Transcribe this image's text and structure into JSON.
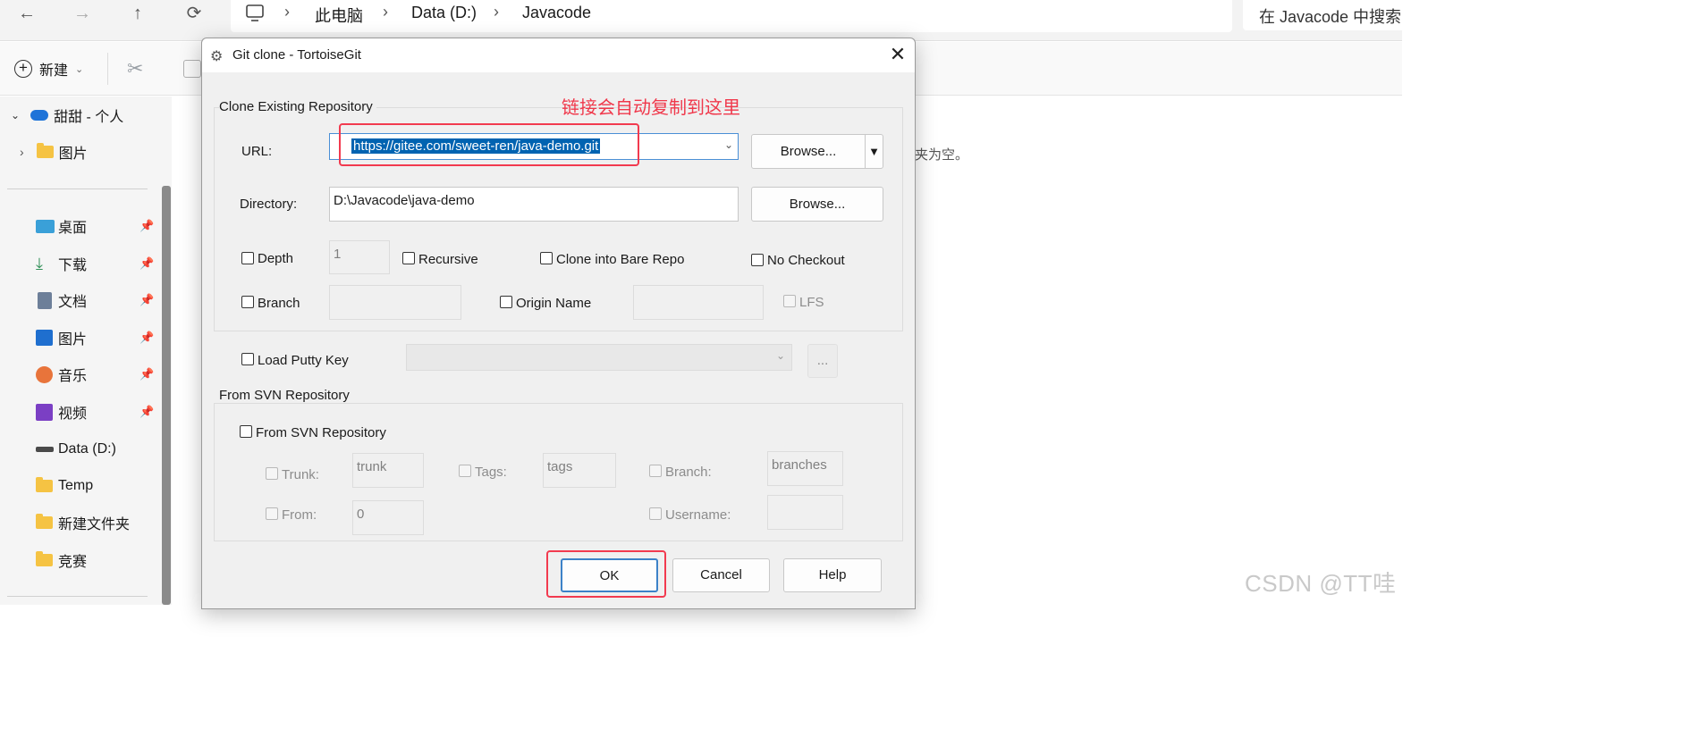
{
  "explorer": {
    "nav": {
      "back": "←",
      "forward": "→",
      "up": "↑",
      "refresh": "⟳"
    },
    "breadcrumb": [
      "此电脑",
      "Data (D:)",
      "Javacode"
    ],
    "search_placeholder": "在 Javacode 中搜索",
    "toolbar": {
      "new_label": "新建"
    },
    "sidebar": {
      "onedrive": "甜甜 - 个人",
      "onedrive_child": "图片",
      "quick": [
        {
          "label": "桌面",
          "icon": "desktop-icon"
        },
        {
          "label": "下载",
          "icon": "download-icon"
        },
        {
          "label": "文档",
          "icon": "document-icon"
        },
        {
          "label": "图片",
          "icon": "pictures-icon"
        },
        {
          "label": "音乐",
          "icon": "music-icon"
        },
        {
          "label": "视频",
          "icon": "video-icon"
        }
      ],
      "drive": "Data (D:)",
      "folders": [
        "Temp",
        "新建文件夹",
        "竞赛"
      ]
    },
    "empty_text": "夹为空。"
  },
  "dialog": {
    "title": "Git clone - TortoiseGit",
    "clone_group": "Clone Existing Repository",
    "url_label": "URL:",
    "url_value": "https://gitee.com/sweet-ren/java-demo.git",
    "browse_label": "Browse...",
    "directory_label": "Directory:",
    "directory_value": "D:\\Javacode\\java-demo",
    "browse2_label": "Browse...",
    "depth_label": "Depth",
    "depth_value": "1",
    "recursive_label": "Recursive",
    "bare_label": "Clone into Bare Repo",
    "no_checkout_label": "No Checkout",
    "branch_label": "Branch",
    "origin_label": "Origin Name",
    "lfs_label": "LFS",
    "putty_label": "Load Putty Key",
    "putty_btn": "...",
    "svn_group": "From SVN Repository",
    "svn_check": "From SVN Repository",
    "trunk_label": "Trunk:",
    "trunk_value": "trunk",
    "tags_label": "Tags:",
    "tags_value": "tags",
    "svn_branch_label": "Branch:",
    "branches_value": "branches",
    "from_label": "From:",
    "from_value": "0",
    "username_label": "Username:",
    "ok_label": "OK",
    "cancel_label": "Cancel",
    "help_label": "Help"
  },
  "annotation": "链接会自动复制到这里",
  "watermark": "CSDN @TT哇",
  "colors": {
    "annotation_red": "#f0384b",
    "selection_blue": "#0063b1"
  }
}
